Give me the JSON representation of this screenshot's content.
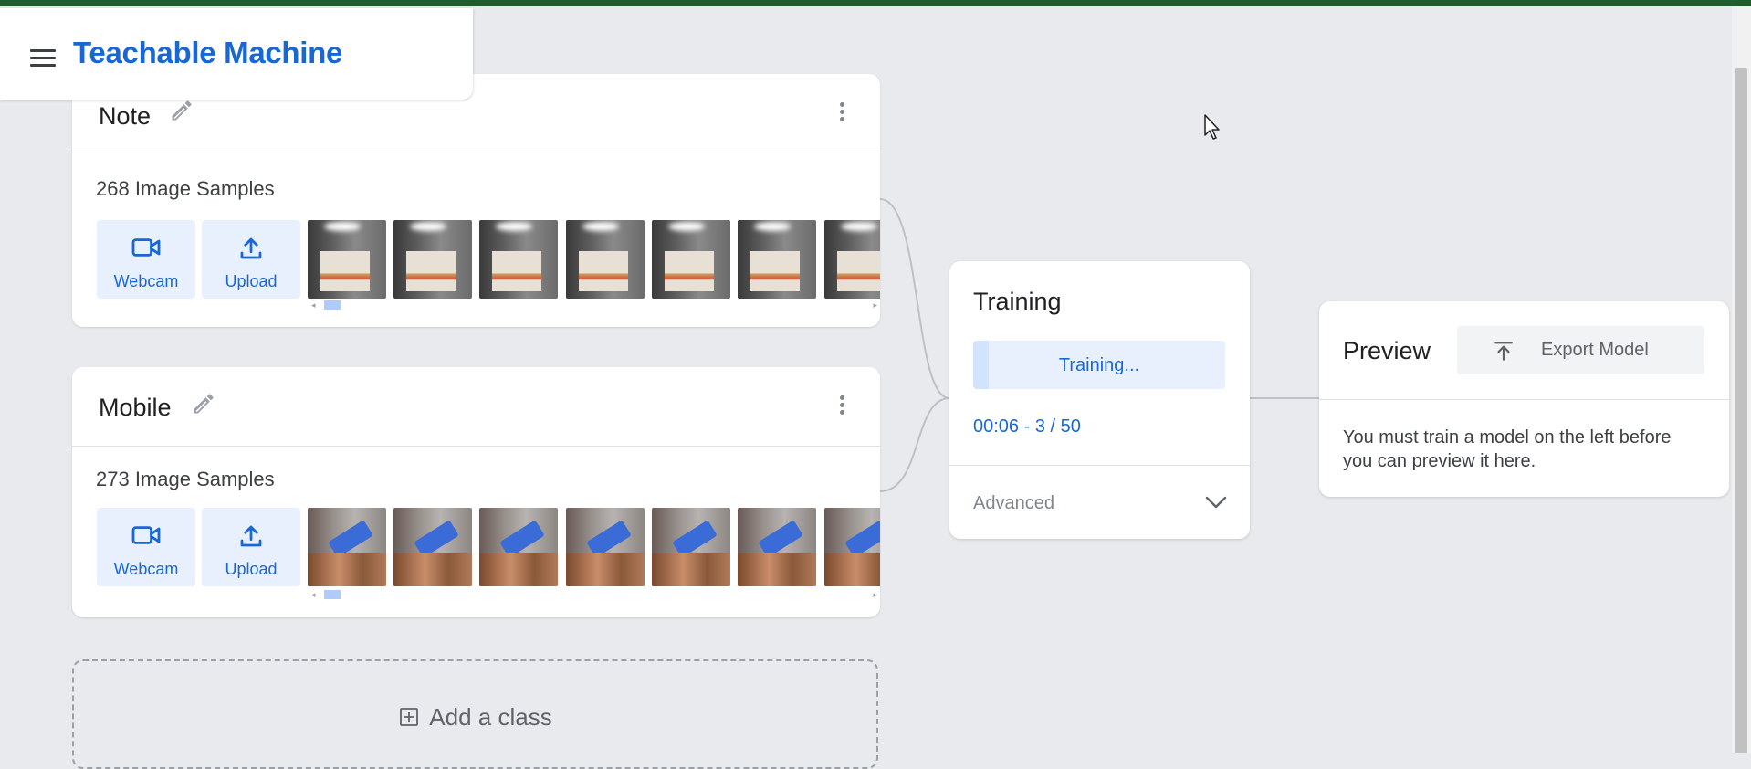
{
  "app": {
    "title": "Teachable Machine"
  },
  "classes": [
    {
      "name": "Note",
      "samples_label": "268 Image Samples",
      "webcam_label": "Webcam",
      "upload_label": "Upload"
    },
    {
      "name": "Mobile",
      "samples_label": "273 Image Samples",
      "webcam_label": "Webcam",
      "upload_label": "Upload"
    }
  ],
  "add_class": {
    "label": "Add a class"
  },
  "training": {
    "title": "Training",
    "button_label": "Training...",
    "status": "00:06 - 3 / 50",
    "progress_fraction": 0.06,
    "advanced_label": "Advanced"
  },
  "preview": {
    "title": "Preview",
    "export_label": "Export Model",
    "message": "You must train a model on the left before you can preview it here."
  },
  "colors": {
    "accent": "#1967d2",
    "button_bg": "#e8f0fe",
    "page_bg": "#e8eaed",
    "top_strip": "#1e5e2d"
  },
  "icons": {
    "menu": "menu-icon",
    "edit": "pencil-icon",
    "more": "more-vert-icon",
    "webcam": "videocam-icon",
    "upload": "upload-icon",
    "add": "add-box-icon",
    "expand": "chevron-down-icon",
    "export": "export-icon"
  }
}
